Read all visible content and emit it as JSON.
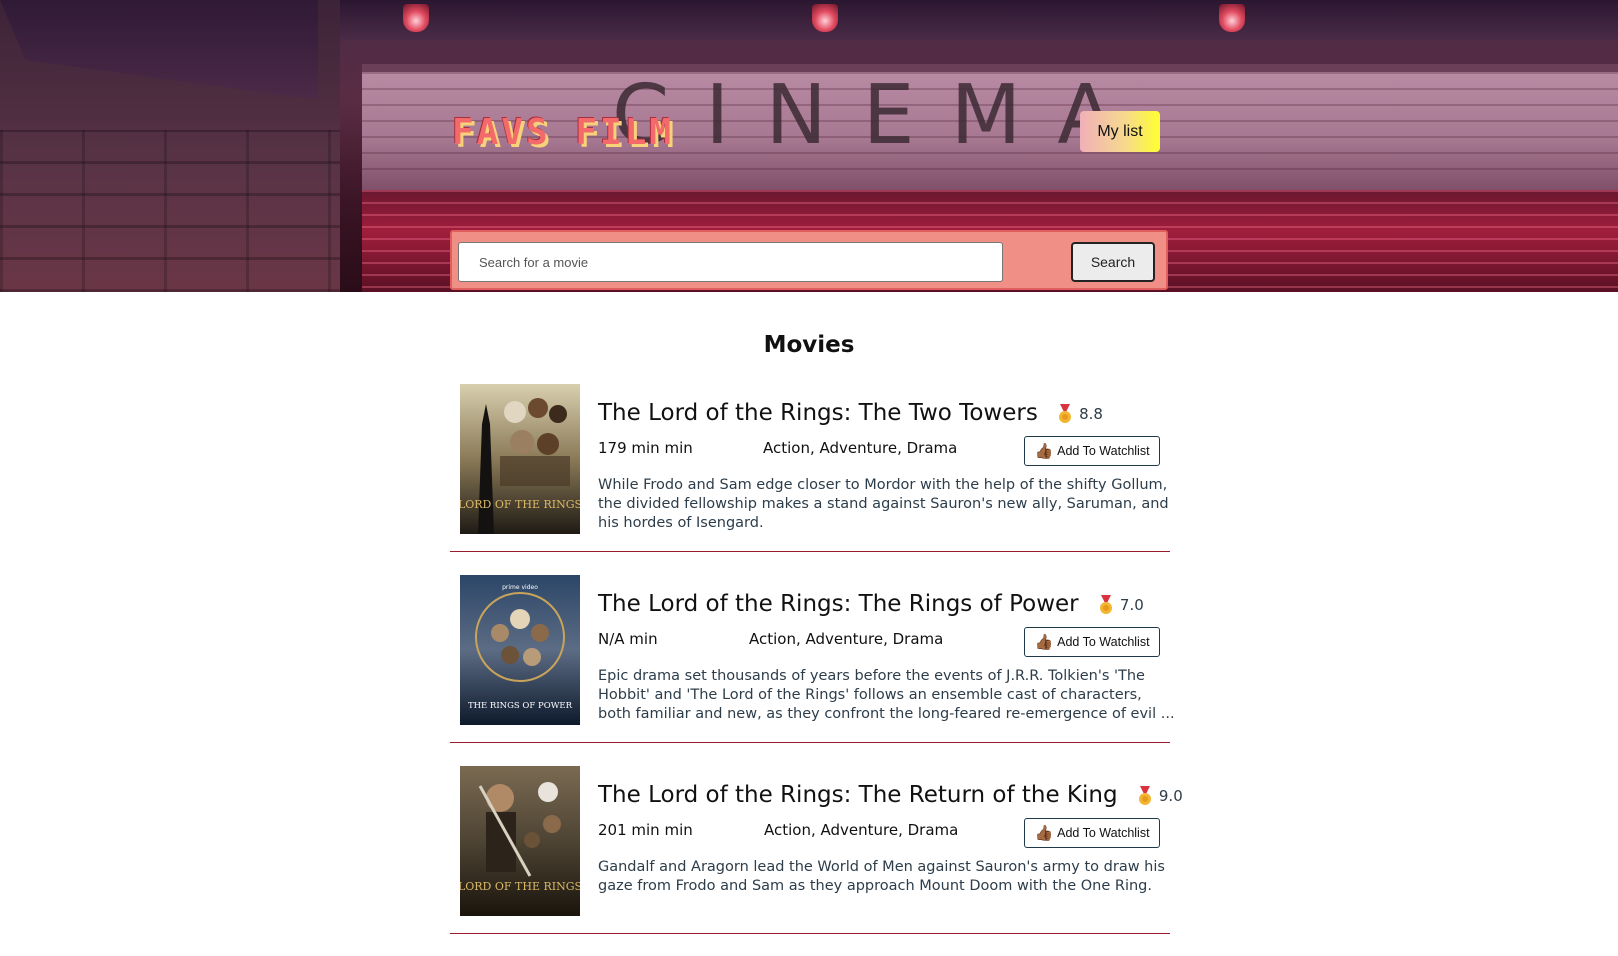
{
  "header": {
    "logo": "FAVS FILM",
    "hero_word": "CINEMA",
    "my_list_label": "My list"
  },
  "search": {
    "placeholder": "Search for a movie",
    "button_label": "Search"
  },
  "section_title": "Movies",
  "movies": [
    {
      "title": "The Lord of the Rings: The Two Towers",
      "rating": "8.8",
      "runtime": "179 min min",
      "genre": "Action, Adventure, Drama",
      "watchlist_label": "Add To Watchlist",
      "plot": "While Frodo and Sam edge closer to Mordor with the help of the shifty Gollum, the divided fellowship makes a stand against Sauron's new ally, Saruman, and his hordes of Isengard."
    },
    {
      "title": "The Lord of the Rings: The Rings of Power",
      "rating": "7.0",
      "runtime": "N/A min",
      "genre": "Action, Adventure, Drama",
      "watchlist_label": "Add To Watchlist",
      "plot": "Epic drama set thousands of years before the events of J.R.R. Tolkien's 'The Hobbit' and 'The Lord of the Rings' follows an ensemble cast of characters, both familiar and new, as they confront the long-feared re-emergence of evil ..."
    },
    {
      "title": "The Lord of the Rings: The Return of the King",
      "rating": "9.0",
      "runtime": "201 min min",
      "genre": "Action, Adventure, Drama",
      "watchlist_label": "Add To Watchlist",
      "plot": "Gandalf and Aragorn lead the World of Men against Sauron's army to draw his gaze from Frodo and Sam as they approach Mount Doom with the One Ring."
    }
  ],
  "posters": [
    {
      "caption": "LORD OF THE RINGS"
    },
    {
      "caption": "THE RINGS OF POWER",
      "badge": "prime video"
    },
    {
      "caption": "LORD OF THE RINGS"
    }
  ],
  "icons": {
    "rating": "medal-icon",
    "watchlist": "thumbs-up-icon"
  },
  "colors": {
    "search_bar": "#ef8f86",
    "divider": "#9b1c2c",
    "logo": "#f26a6a"
  }
}
